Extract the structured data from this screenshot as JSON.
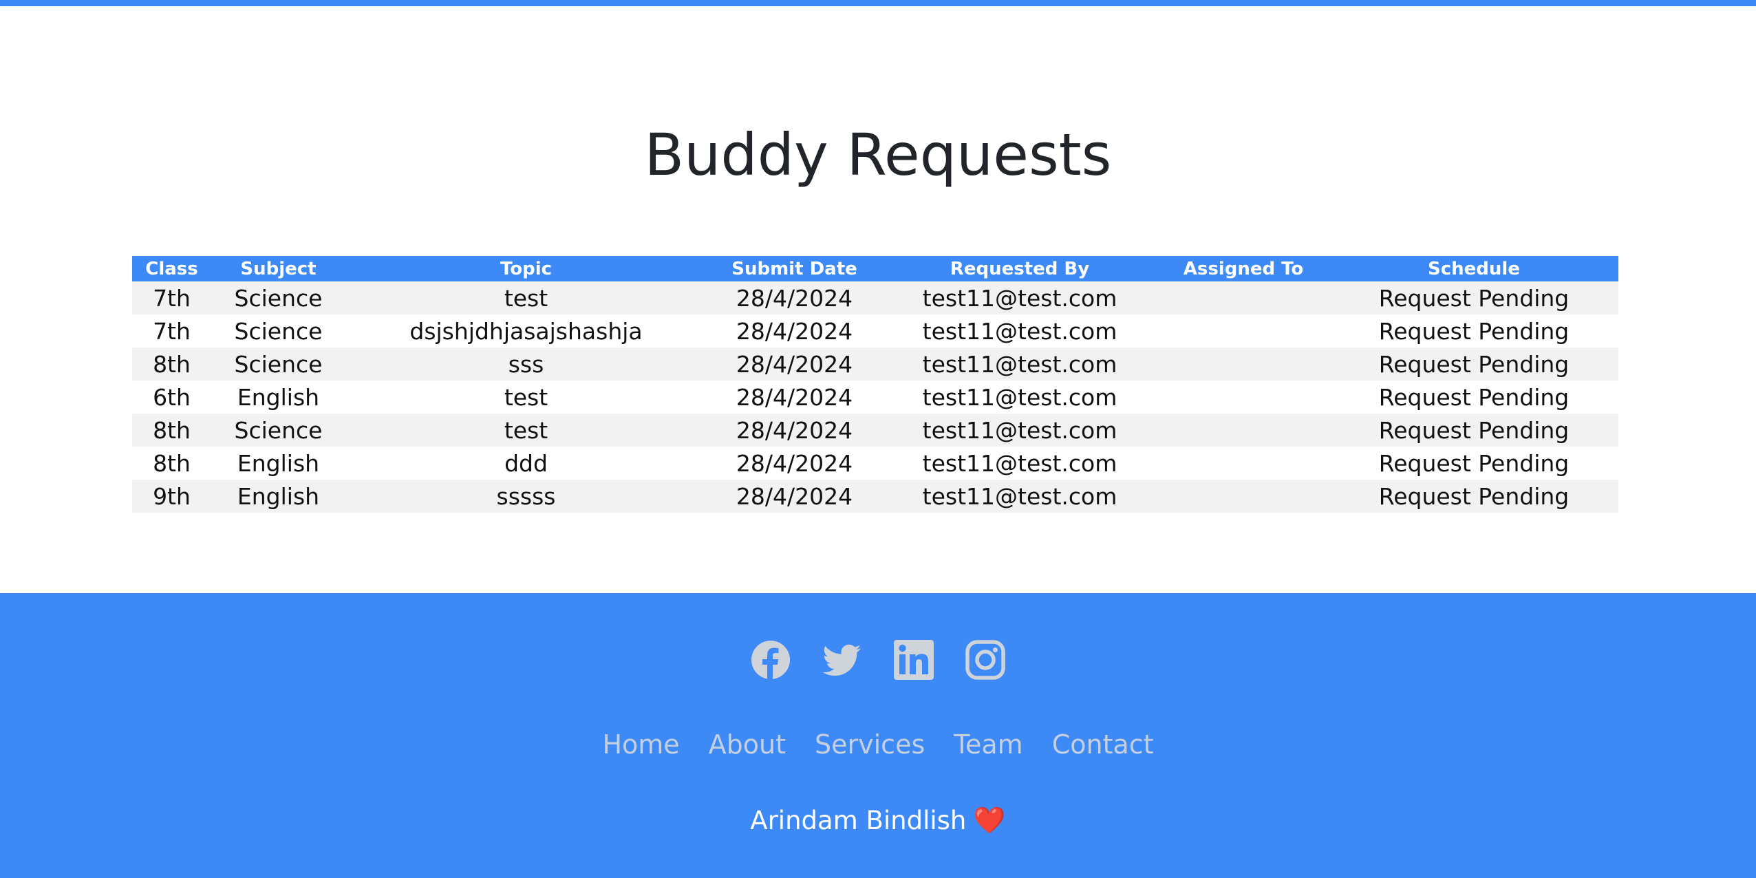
{
  "page": {
    "title": "Buddy Requests"
  },
  "table": {
    "headers": {
      "class": "Class",
      "subject": "Subject",
      "topic": "Topic",
      "submit_date": "Submit Date",
      "requested_by": "Requested By",
      "assigned_to": "Assigned To",
      "schedule": "Schedule"
    },
    "rows": [
      {
        "class": "7th",
        "subject": "Science",
        "topic": "test",
        "submit_date": "28/4/2024",
        "requested_by": "test11@test.com",
        "assigned_to": "",
        "schedule": "Request Pending"
      },
      {
        "class": "7th",
        "subject": "Science",
        "topic": "dsjshjdhjasajshashja",
        "submit_date": "28/4/2024",
        "requested_by": "test11@test.com",
        "assigned_to": "",
        "schedule": "Request Pending"
      },
      {
        "class": "8th",
        "subject": "Science",
        "topic": "sss",
        "submit_date": "28/4/2024",
        "requested_by": "test11@test.com",
        "assigned_to": "",
        "schedule": "Request Pending"
      },
      {
        "class": "6th",
        "subject": "English",
        "topic": "test",
        "submit_date": "28/4/2024",
        "requested_by": "test11@test.com",
        "assigned_to": "",
        "schedule": "Request Pending"
      },
      {
        "class": "8th",
        "subject": "Science",
        "topic": "test",
        "submit_date": "28/4/2024",
        "requested_by": "test11@test.com",
        "assigned_to": "",
        "schedule": "Request Pending"
      },
      {
        "class": "8th",
        "subject": "English",
        "topic": "ddd",
        "submit_date": "28/4/2024",
        "requested_by": "test11@test.com",
        "assigned_to": "",
        "schedule": "Request Pending"
      },
      {
        "class": "9th",
        "subject": "English",
        "topic": "sssss",
        "submit_date": "28/4/2024",
        "requested_by": "test11@test.com",
        "assigned_to": "",
        "schedule": "Request Pending"
      }
    ]
  },
  "footer": {
    "social": [
      {
        "icon": "facebook-icon"
      },
      {
        "icon": "twitter-icon"
      },
      {
        "icon": "linkedin-icon"
      },
      {
        "icon": "instagram-icon"
      }
    ],
    "nav": [
      "Home",
      "About",
      "Services",
      "Team",
      "Contact"
    ],
    "credit": "Arindam Bindlish",
    "credit_emoji": "❤️"
  },
  "colors": {
    "accent": "#3d8af7",
    "row_stripe": "#f2f2f2",
    "icon_gray": "#cfd3da",
    "nav_text": "#c4cfe0"
  }
}
